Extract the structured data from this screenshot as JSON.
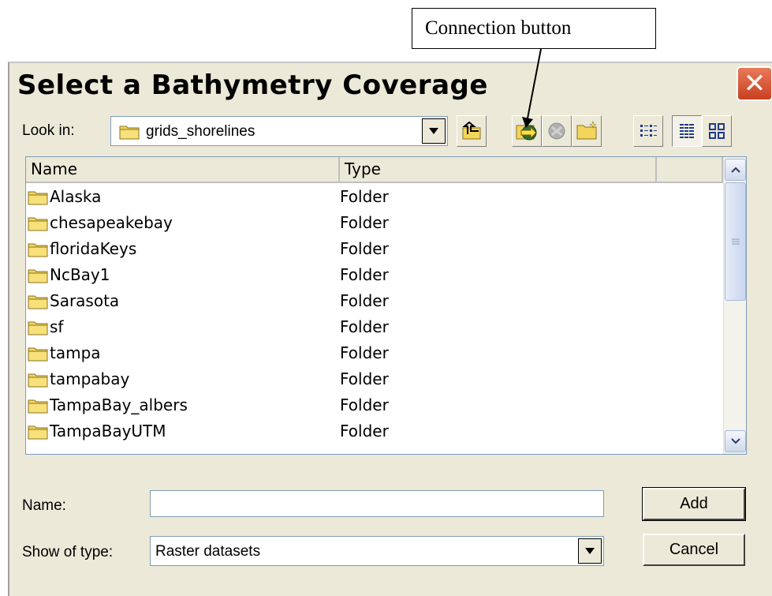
{
  "callout": {
    "text": "Connection button"
  },
  "dialog": {
    "title": "Select a Bathymetry Coverage",
    "close_symbol": "✕",
    "look_in": {
      "label": "Look in:",
      "value": "grids_shorelines"
    },
    "toolbar": [
      "up-one-level-icon",
      "connect-to-folder-icon",
      "disconnect-folder-icon",
      "new-folder-icon",
      "list-view-icon",
      "details-view-icon",
      "thumbnails-view-icon"
    ],
    "list": {
      "columns": [
        "Name",
        "Type"
      ],
      "rows": [
        {
          "name": "Alaska",
          "type": "Folder"
        },
        {
          "name": "chesapeakebay",
          "type": "Folder"
        },
        {
          "name": "floridaKeys",
          "type": "Folder"
        },
        {
          "name": "NcBay1",
          "type": "Folder"
        },
        {
          "name": "Sarasota",
          "type": "Folder"
        },
        {
          "name": "sf",
          "type": "Folder"
        },
        {
          "name": "tampa",
          "type": "Folder"
        },
        {
          "name": "tampabay",
          "type": "Folder"
        },
        {
          "name": "TampaBay_albers",
          "type": "Folder"
        },
        {
          "name": "TampaBayUTM",
          "type": "Folder"
        }
      ]
    },
    "name_field": {
      "label": "Name:",
      "value": ""
    },
    "show_of_type": {
      "label": "Show of type:",
      "value": "Raster datasets"
    },
    "buttons": {
      "add": "Add",
      "cancel": "Cancel"
    }
  },
  "colors": {
    "dialog_bg": "#ece9d8",
    "close_red": "#d0502a",
    "folder_yellow": "#f3d55b",
    "field_border": "#7f9db9"
  }
}
